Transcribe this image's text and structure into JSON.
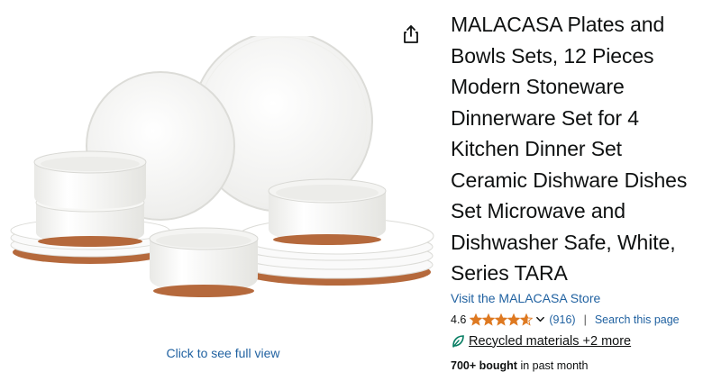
{
  "product": {
    "title": "MALACASA Plates and Bowls Sets, 12 Pieces Modern Stoneware Dinnerware Set for 4 Kitchen Dinner Set Ceramic Dishware Dishes Set Microwave and Dishwasher Safe, White, Series TARA",
    "store_link": "Visit the MALACASA Store",
    "rating": "4.6",
    "rating_value": 4.6,
    "rating_max": 5,
    "review_count": "(916)",
    "search_link": "Search this page",
    "sustainability": "Recycled materials +2 more",
    "bought_bold": "700+ bought",
    "bought_rest": " in past month",
    "image_caption": "Click to see full view",
    "image_alt": "12-piece white stoneware dinnerware set with terracotta-colored bases"
  },
  "icons": {
    "share": "share-icon",
    "star": "star-icon",
    "chevron": "chevron-down-icon",
    "leaf": "leaf-icon"
  },
  "colors": {
    "link": "#2162a1",
    "star": "#de7921",
    "text": "#0f1111",
    "leaf": "#067d62"
  }
}
